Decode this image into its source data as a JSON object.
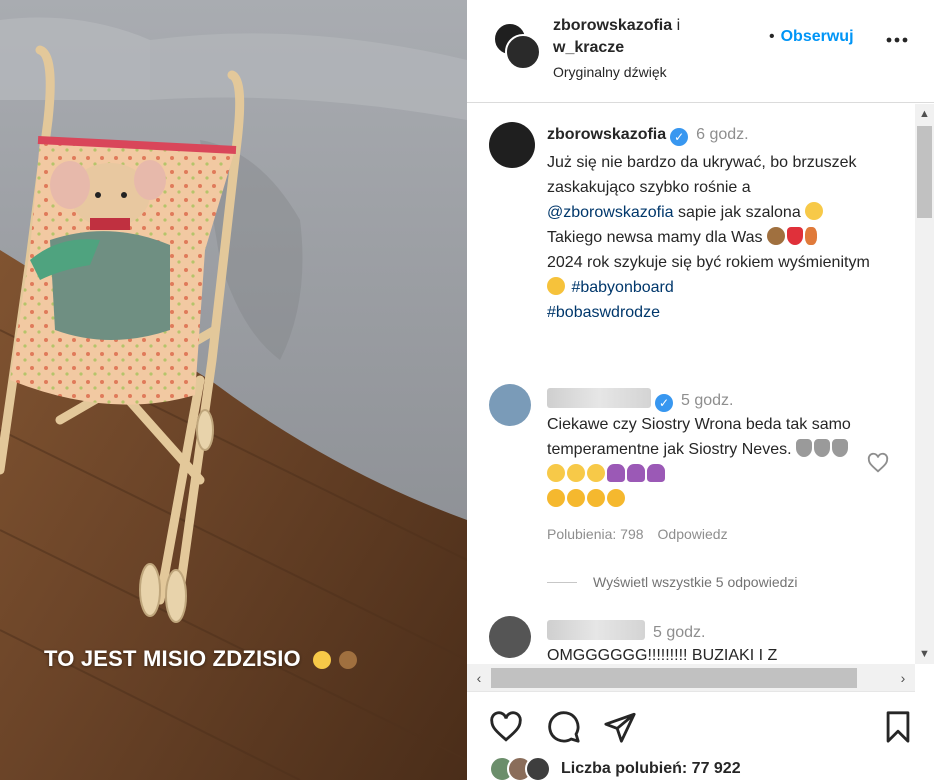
{
  "media": {
    "caption": "TO JEST MISIO ZDZISIO",
    "caption_emojis": [
      "pleading-face",
      "bear-face"
    ]
  },
  "header": {
    "username_primary": "zborowskazofia",
    "conjunction": "i",
    "username_secondary": "w_kracze",
    "audio_label": "Oryginalny dźwięk",
    "follow_separator": "•",
    "follow_label": "Obserwuj",
    "more_icon": "more-horizontal-icon"
  },
  "caption": {
    "username": "zborowskazofia",
    "verified": true,
    "time": "6 godz.",
    "text_1": "Już się nie bardzo da ukrywać, bo brzuszek zaskakująco szybko rośnie a",
    "mention": "@zborowskazofia",
    "text_2": "sapie jak szalona",
    "text_3": "Takiego newsa mamy dla Was",
    "text_4": "2024 rok szykuje się być rokiem wyśmienitym",
    "hashtag_1": "#babyonboard",
    "hashtag_2": "#bobaswdrodze"
  },
  "comment_1": {
    "time": "5 godz.",
    "verified": true,
    "text": "Ciekawe czy Siostry Wrona beda tak samo temperamentne jak Siostry Neves.",
    "likes_label": "Polubienia: 798",
    "reply_label": "Odpowiedz",
    "view_replies_label": "Wyświetl wszystkie 5 odpowiedzi"
  },
  "comment_2": {
    "time": "5 godz.",
    "text": "OMGGGGGG!!!!!!!!! BUZIAKI I Z"
  },
  "actions": {
    "like_icon": "heart-outline-icon",
    "comment_icon": "comment-icon",
    "share_icon": "send-icon",
    "save_icon": "bookmark-icon"
  },
  "likes": {
    "label": "Liczba polubień: 77 922"
  },
  "colors": {
    "link": "#00376b",
    "follow": "#0095f6",
    "muted": "#8e8e8e",
    "verified": "#3897f0"
  }
}
